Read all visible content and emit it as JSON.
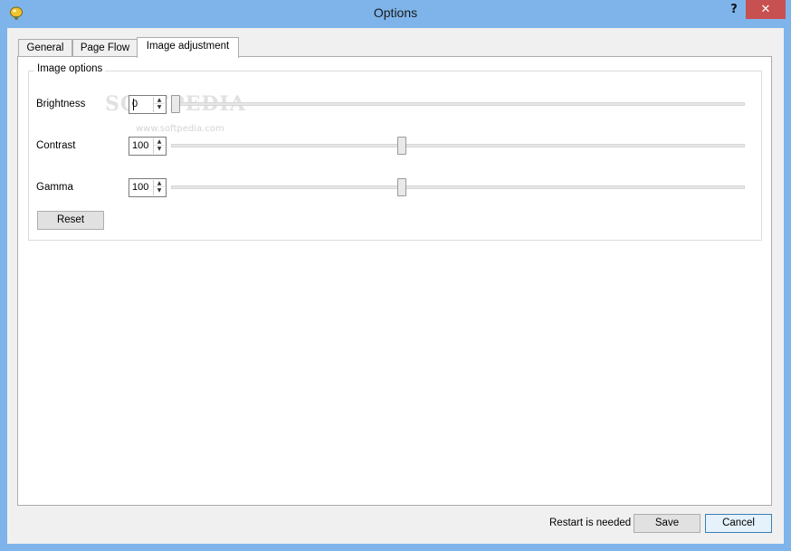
{
  "window": {
    "title": "Options",
    "help_label": "?",
    "close_label": "✕"
  },
  "tabs": [
    {
      "label": "General",
      "active": false
    },
    {
      "label": "Page Flow",
      "active": false
    },
    {
      "label": "Image adjustment",
      "active": true
    }
  ],
  "image_options": {
    "group_title": "Image options",
    "brightness": {
      "label": "Brightness",
      "value": "0",
      "slider_fraction": 0.0
    },
    "contrast": {
      "label": "Contrast",
      "value": "100",
      "slider_fraction": 0.4
    },
    "gamma": {
      "label": "Gamma",
      "value": "100",
      "slider_fraction": 0.4
    },
    "reset_label": "Reset"
  },
  "watermark": {
    "text": "SOFTPEDIA",
    "sub": "www.softpedia.com"
  },
  "footer": {
    "status": "Restart is needed",
    "save_label": "Save",
    "cancel_label": "Cancel"
  },
  "colors": {
    "frame": "#7eb4ea",
    "close": "#c75050",
    "panel": "#ffffff",
    "dialog": "#f0f0f0"
  },
  "icons": {
    "app": "yellow-balloon-icon",
    "spin_up": "arrow-up-icon",
    "spin_down": "arrow-down-icon"
  }
}
